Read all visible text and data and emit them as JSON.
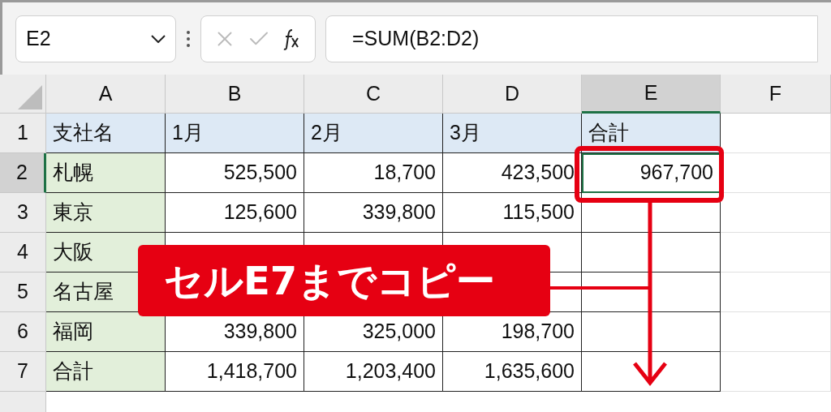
{
  "name_box": {
    "value": "E2"
  },
  "formula_bar": {
    "value": "=SUM(B2:D2)"
  },
  "columns": [
    {
      "label": "A",
      "selected": false
    },
    {
      "label": "B",
      "selected": false
    },
    {
      "label": "C",
      "selected": false
    },
    {
      "label": "D",
      "selected": false
    },
    {
      "label": "E",
      "selected": true
    },
    {
      "label": "F",
      "selected": false
    }
  ],
  "rows": [
    {
      "header": "1",
      "selected": false,
      "cells": [
        {
          "kind": "header",
          "text": "支社名"
        },
        {
          "kind": "header",
          "text": "1月"
        },
        {
          "kind": "header",
          "text": "2月"
        },
        {
          "kind": "header",
          "text": "3月"
        },
        {
          "kind": "header",
          "text": "合計"
        },
        {
          "kind": "blank"
        }
      ]
    },
    {
      "header": "2",
      "selected": true,
      "cells": [
        {
          "kind": "label",
          "text": "札幌"
        },
        {
          "kind": "number",
          "text": "525,500"
        },
        {
          "kind": "number",
          "text": "18,700"
        },
        {
          "kind": "number",
          "text": "423,500"
        },
        {
          "kind": "number",
          "text": "967,700",
          "selected": true
        },
        {
          "kind": "blank"
        }
      ]
    },
    {
      "header": "3",
      "selected": false,
      "cells": [
        {
          "kind": "label",
          "text": "東京"
        },
        {
          "kind": "number",
          "text": "125,600"
        },
        {
          "kind": "number",
          "text": "339,800"
        },
        {
          "kind": "number",
          "text": "115,500"
        },
        {
          "kind": "number"
        },
        {
          "kind": "blank"
        }
      ]
    },
    {
      "header": "4",
      "selected": false,
      "cells": [
        {
          "kind": "label",
          "text": "大阪"
        },
        {
          "kind": "number"
        },
        {
          "kind": "number"
        },
        {
          "kind": "number"
        },
        {
          "kind": "number"
        },
        {
          "kind": "blank"
        }
      ]
    },
    {
      "header": "5",
      "selected": false,
      "cells": [
        {
          "kind": "label",
          "text": "名古屋"
        },
        {
          "kind": "number"
        },
        {
          "kind": "number"
        },
        {
          "kind": "number"
        },
        {
          "kind": "number"
        },
        {
          "kind": "blank"
        }
      ]
    },
    {
      "header": "6",
      "selected": false,
      "cells": [
        {
          "kind": "label",
          "text": "福岡"
        },
        {
          "kind": "number",
          "text": "339,800"
        },
        {
          "kind": "number",
          "text": "325,000"
        },
        {
          "kind": "number",
          "text": "198,700"
        },
        {
          "kind": "number"
        },
        {
          "kind": "blank"
        }
      ]
    },
    {
      "header": "7",
      "selected": false,
      "cells": [
        {
          "kind": "label",
          "text": "合計"
        },
        {
          "kind": "number",
          "text": "1,418,700"
        },
        {
          "kind": "number",
          "text": "1,203,400"
        },
        {
          "kind": "number",
          "text": "1,635,600"
        },
        {
          "kind": "number"
        },
        {
          "kind": "blank"
        }
      ]
    }
  ],
  "callout": {
    "text": "セルE7までコピー"
  }
}
